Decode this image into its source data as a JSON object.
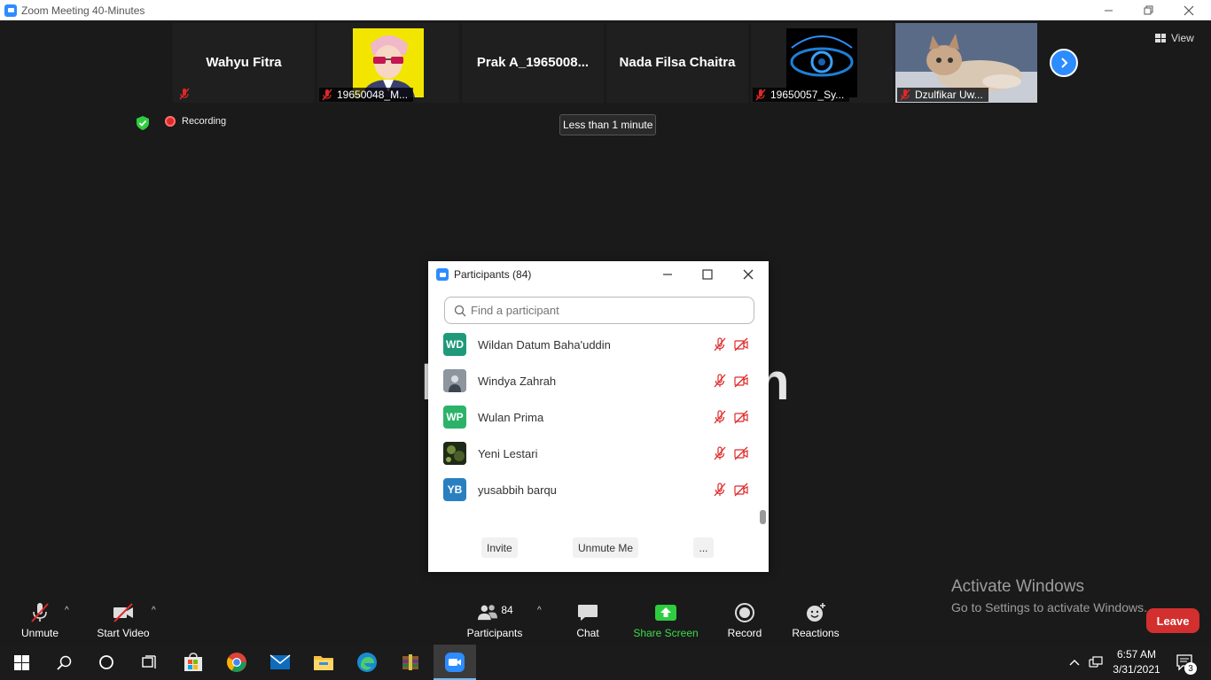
{
  "window": {
    "title": "Zoom Meeting 40-Minutes"
  },
  "gallery": {
    "tiles": [
      {
        "name": "Wahyu Fitra",
        "label": ""
      },
      {
        "name": "",
        "label": "19650048_M..."
      },
      {
        "name": "Prak A_1965008...",
        "label": ""
      },
      {
        "name": "Nada Filsa Chaitra",
        "label": ""
      },
      {
        "name": "",
        "label": "19650057_Sy..."
      },
      {
        "name": "",
        "label": "Dzulfikar Uw..."
      }
    ],
    "view_label": "View"
  },
  "status": {
    "recording_label": "Recording",
    "timer": "Less than 1 minute"
  },
  "background_text": {
    "left": "I",
    "right": "n"
  },
  "participants_panel": {
    "title": "Participants (84)",
    "search_placeholder": "Find a participant",
    "participants": [
      {
        "initials": "WD",
        "name": "Wildan Datum Baha'uddin",
        "color": "#1e9a7a"
      },
      {
        "initials": "",
        "name": "Windya Zahrah",
        "color": "#5b6168"
      },
      {
        "initials": "WP",
        "name": "Wulan Prima",
        "color": "#2bb36a"
      },
      {
        "initials": "",
        "name": "Yeni Lestari",
        "color": "#2d3b22"
      },
      {
        "initials": "YB",
        "name": "yusabbih barqu",
        "color": "#2a7fc0"
      }
    ],
    "buttons": {
      "invite": "Invite",
      "unmute_me": "Unmute Me",
      "more": "..."
    }
  },
  "watermark": {
    "line1": "Activate Windows",
    "line2": "Go to Settings to activate Windows."
  },
  "toolbar": {
    "unmute": "Unmute",
    "start_video": "Start Video",
    "participants_count": "84",
    "participants": "Participants",
    "chat": "Chat",
    "share_screen": "Share Screen",
    "record": "Record",
    "reactions": "Reactions",
    "leave": "Leave"
  },
  "taskbar": {
    "time": "6:57 AM",
    "date": "3/31/2021",
    "notification_count": "3"
  },
  "colors": {
    "accent": "#2d8cff",
    "share_green": "#2ecc40",
    "leave_red": "#d32f2f",
    "muted_red": "#e02828"
  }
}
